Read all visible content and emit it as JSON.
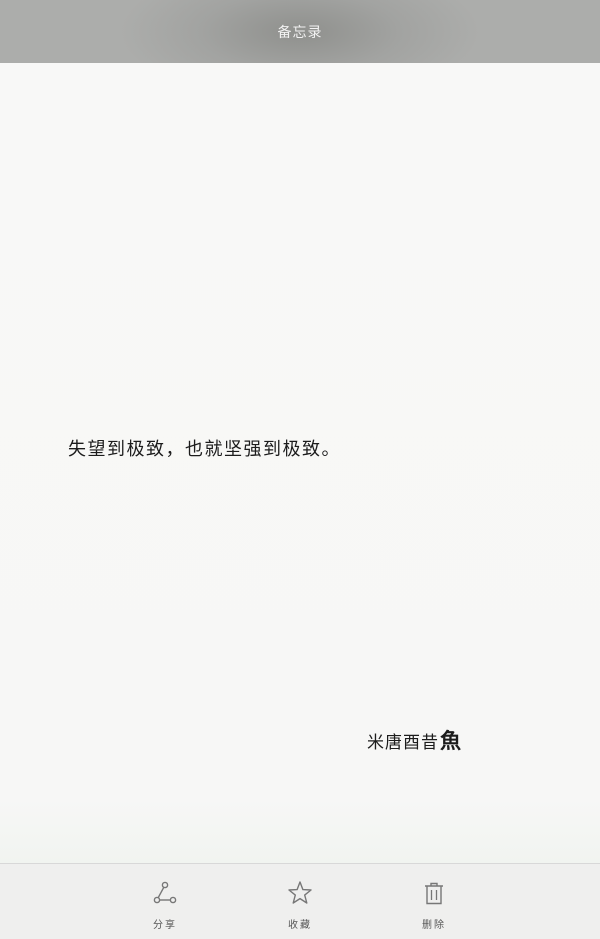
{
  "header": {
    "title": "备忘录"
  },
  "note": {
    "text": "失望到极致，也就坚强到极致。",
    "signature_main": "米唐酉昔",
    "signature_emphasis": "魚"
  },
  "toolbar": {
    "share": {
      "label": "分享",
      "icon": "share-icon"
    },
    "favorite": {
      "label": "收藏",
      "icon": "star-icon"
    },
    "delete": {
      "label": "删除",
      "icon": "trash-icon"
    }
  },
  "colors": {
    "header_bg": "#a2a3a1",
    "page_bg": "#f7f7f6",
    "toolbar_bg": "#efefee",
    "icon": "#777777"
  }
}
